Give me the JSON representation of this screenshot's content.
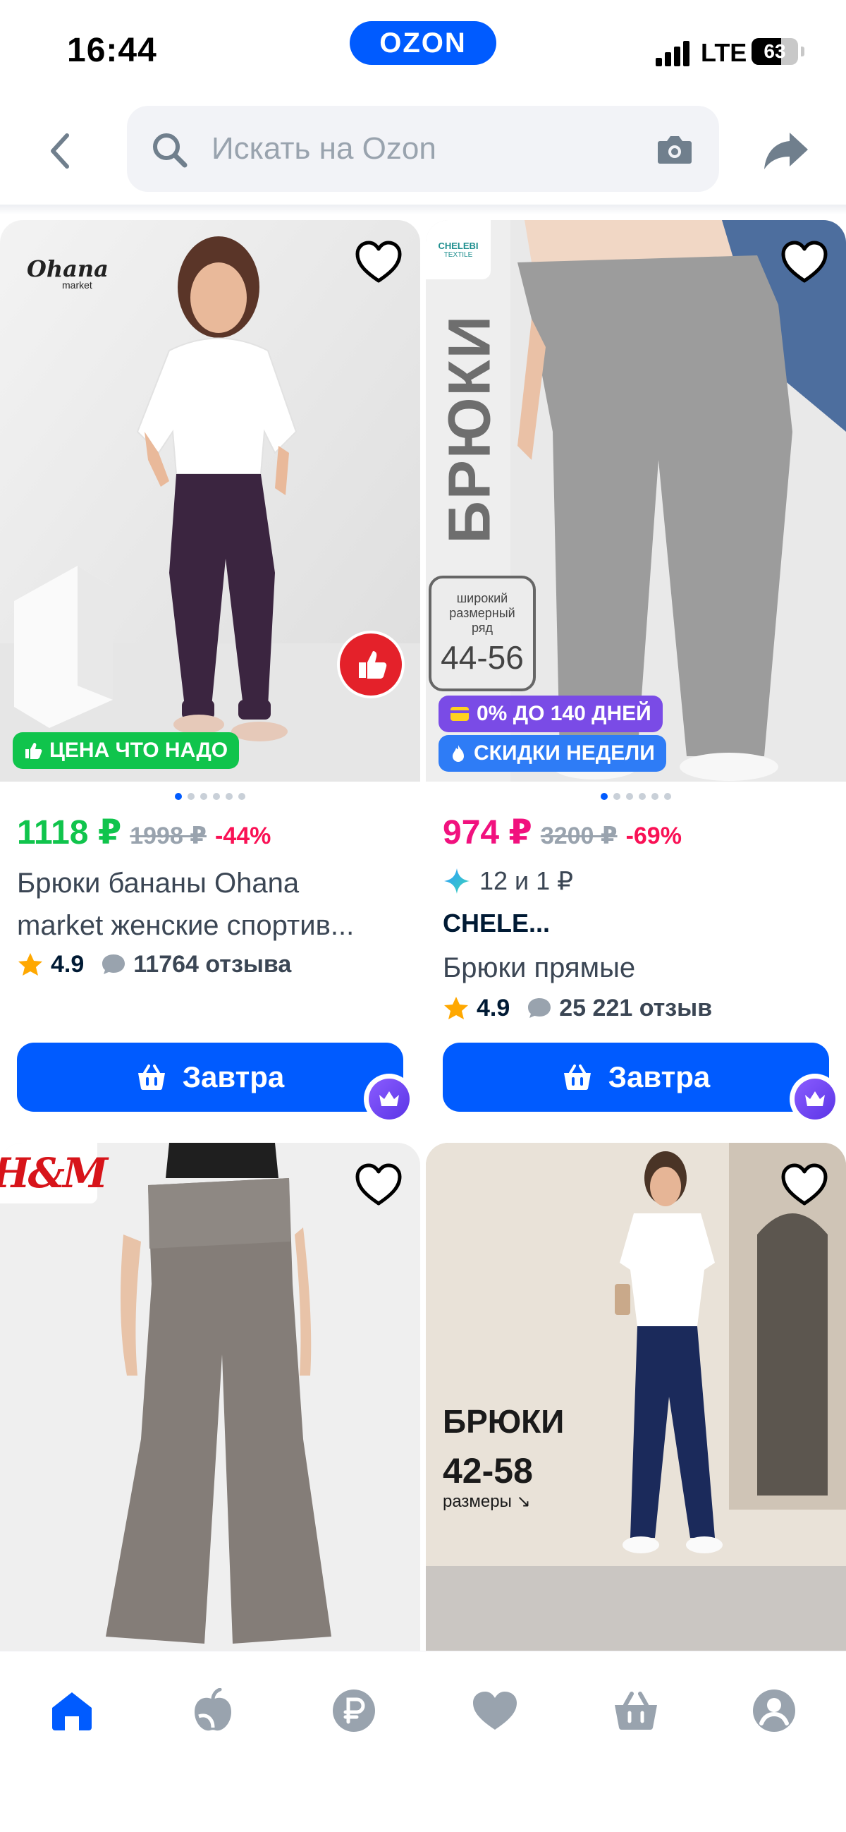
{
  "status_bar": {
    "time": "16:44",
    "logo": "OZON",
    "network": "LTE",
    "battery_level": "63",
    "battery_fraction": 0.63
  },
  "search": {
    "placeholder": "Искать на Ozon",
    "back_icon": "chevron-left-icon",
    "search_icon": "search-icon",
    "camera_icon": "camera-icon",
    "share_icon": "share-icon"
  },
  "colors": {
    "accent": "#005bff",
    "green_price": "#10c44c",
    "pink_price": "#f1117e",
    "discount": "#f91155",
    "muted": "#99a3ae"
  },
  "products": [
    {
      "brand_logo": "Ohana",
      "brand_logo_sub": "market",
      "badge": "ЦЕНА ЧТО НАДО",
      "price": "1118 ₽",
      "old_price": "1998 ₽",
      "discount": "-44%",
      "title_line1": "Брюки бананы Ohana",
      "title_line2": "market женские спортив...",
      "rating": "4.9",
      "reviews": "11764 отзыва",
      "button": "Завтра",
      "dots_total": 6,
      "dots_active": 1
    },
    {
      "brand_logo": "CHELEBI",
      "brand_logo_sub": "TEXTILE",
      "vertical_text": "БРЮКИ",
      "size_caption": "широкий размерный ряд",
      "size_range": "44-56",
      "badge_installment": "0% ДО 140 ДНЕЙ",
      "badge_sale": "СКИДКИ НЕДЕЛИ",
      "price": "974 ₽",
      "old_price": "3200 ₽",
      "discount": "-69%",
      "promo": "12 и 1 ₽",
      "seller": "CHELE...",
      "title": "Брюки прямые",
      "rating": "4.9",
      "reviews": "25 221 отзыв",
      "button": "Завтра",
      "dots_total": 6,
      "dots_active": 1
    },
    {
      "brand_logo": "H&M"
    },
    {
      "overlay_title": "БРЮКИ",
      "overlay_sizes": "42-58",
      "overlay_caption": "размеры ↘"
    }
  ],
  "bottom_nav": [
    {
      "name": "home-icon",
      "active": true
    },
    {
      "name": "fresh-icon",
      "active": false
    },
    {
      "name": "ruble-icon",
      "active": false
    },
    {
      "name": "favorites-icon",
      "active": false
    },
    {
      "name": "cart-icon",
      "active": false
    },
    {
      "name": "profile-icon",
      "active": false
    }
  ]
}
